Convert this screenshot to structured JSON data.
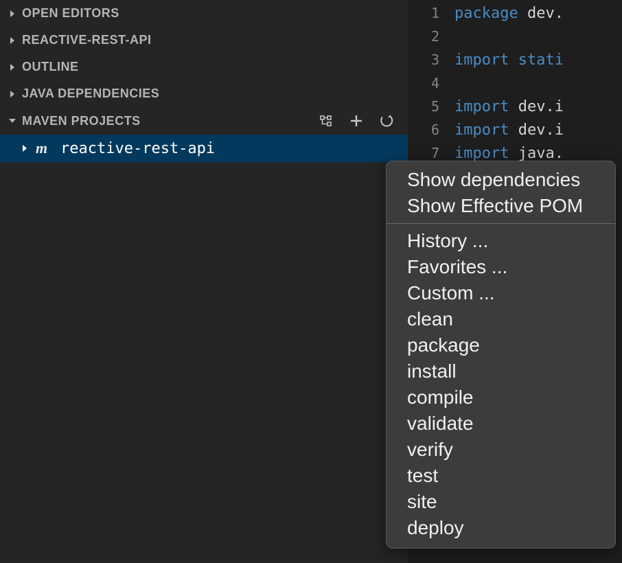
{
  "sidebar": {
    "sections": [
      {
        "label": "OPEN EDITORS",
        "expanded": false
      },
      {
        "label": "REACTIVE-REST-API",
        "expanded": false
      },
      {
        "label": "OUTLINE",
        "expanded": false
      },
      {
        "label": "JAVA DEPENDENCIES",
        "expanded": false
      },
      {
        "label": "MAVEN PROJECTS",
        "expanded": true
      }
    ],
    "maven_project": "reactive-rest-api"
  },
  "editor": {
    "lines": [
      {
        "num": "1",
        "tokens": [
          {
            "t": "kw",
            "v": "package"
          },
          {
            "t": "pl",
            "v": " dev."
          }
        ]
      },
      {
        "num": "2",
        "tokens": []
      },
      {
        "num": "3",
        "tokens": [
          {
            "t": "kw",
            "v": "import"
          },
          {
            "t": "pl",
            "v": " "
          },
          {
            "t": "kw2",
            "v": "stati"
          }
        ]
      },
      {
        "num": "4",
        "tokens": []
      },
      {
        "num": "5",
        "tokens": [
          {
            "t": "kw",
            "v": "import"
          },
          {
            "t": "pl",
            "v": " dev.i"
          }
        ]
      },
      {
        "num": "6",
        "tokens": [
          {
            "t": "kw",
            "v": "import"
          },
          {
            "t": "pl",
            "v": " dev.i"
          }
        ]
      },
      {
        "num": "7",
        "tokens": [
          {
            "t": "kw",
            "v": "import"
          },
          {
            "t": "pl",
            "v": " java."
          }
        ]
      }
    ]
  },
  "context_menu": {
    "group1": [
      "Show dependencies",
      "Show Effective POM"
    ],
    "group2": [
      "History ...",
      "Favorites ...",
      "Custom ...",
      "clean",
      "package",
      "install",
      "compile",
      "validate",
      "verify",
      "test",
      "site",
      "deploy"
    ]
  }
}
